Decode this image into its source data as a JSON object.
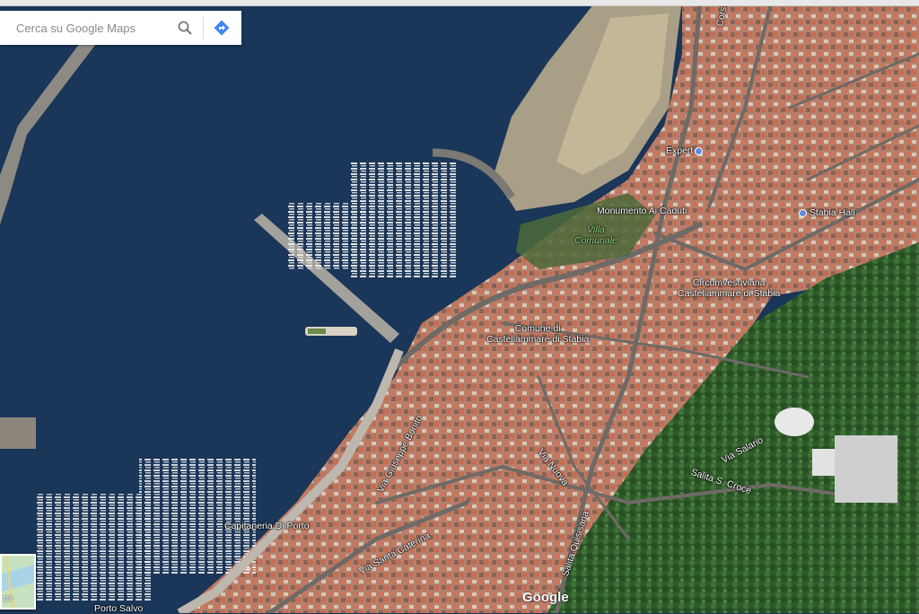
{
  "search": {
    "placeholder": "Cerca su Google Maps"
  },
  "labels": {
    "corso": "Corso",
    "expert": "Expert",
    "monumento": "Monumento Ai Caduti",
    "villa_1": "Villa",
    "villa_2": "Comunale",
    "stabia_hall": "Stabia Hall",
    "circum_1": "Circumvesuviana",
    "circum_2": "Castellammare di Stabia",
    "comune_1": "Comune di",
    "comune_2": "Castellammare di Stabia",
    "via_bonito": "Via Giuseppe Bonito",
    "via_nuova": "Via Nuova",
    "via_salario": "Via Salario",
    "salita_croce": "Salita S. Croce",
    "capitaneria": "Capitaneria Di Porto",
    "via_caterina": "Via Santa Caterina",
    "salita_quisisana": "Salita Quisisana",
    "porto_salvo": "Porto Salvo"
  },
  "google_logo": "Google",
  "minimap": {
    "label": "pa"
  },
  "colors": {
    "sea": "#1a3658",
    "land": "#b58e78",
    "greenery": "#3a6a32",
    "roads": "#6e6a66",
    "beach": "#a89f86"
  },
  "icons": {
    "search": "magnifier-icon",
    "directions": "directions-icon",
    "poi": "poi-dot-icon"
  }
}
